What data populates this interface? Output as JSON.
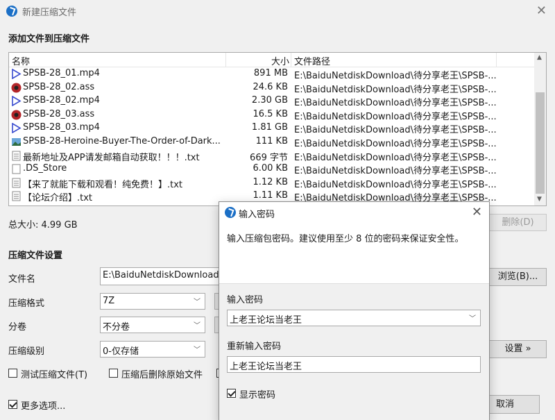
{
  "window": {
    "title": "新建压缩文件",
    "close_glyph": "✕"
  },
  "files_section": {
    "title": "添加文件到压缩文件"
  },
  "list": {
    "columns": [
      "名称",
      "大小",
      "文件路径"
    ],
    "rows": [
      {
        "name": "SPSB-28_01.mp4",
        "size": "891 MB",
        "path": "E:\\BaiduNetdiskDownload\\待分享老王\\SPSB-...",
        "icon": "video-file-icon"
      },
      {
        "name": "SPSB-28_02.ass",
        "size": "24.6 KB",
        "path": "E:\\BaiduNetdiskDownload\\待分享老王\\SPSB-...",
        "icon": "subtitle-file-icon"
      },
      {
        "name": "SPSB-28_02.mp4",
        "size": "2.30 GB",
        "path": "E:\\BaiduNetdiskDownload\\待分享老王\\SPSB-...",
        "icon": "video-file-icon"
      },
      {
        "name": "SPSB-28_03.ass",
        "size": "16.5 KB",
        "path": "E:\\BaiduNetdiskDownload\\待分享老王\\SPSB-...",
        "icon": "subtitle-file-icon"
      },
      {
        "name": "SPSB-28_03.mp4",
        "size": "1.81 GB",
        "path": "E:\\BaiduNetdiskDownload\\待分享老王\\SPSB-...",
        "icon": "video-file-icon"
      },
      {
        "name": "SPSB-28-Heroine-Buyer-The-Order-of-Dark...",
        "size": "111 KB",
        "path": "E:\\BaiduNetdiskDownload\\待分享老王\\SPSB-...",
        "icon": "image-file-icon"
      },
      {
        "name": "最新地址及APP请发邮箱自动获取！！！.txt",
        "size": "669 字节",
        "path": "E:\\BaiduNetdiskDownload\\待分享老王\\SPSB-...",
        "icon": "text-file-icon"
      },
      {
        "name": ".DS_Store",
        "size": "6.00 KB",
        "path": "E:\\BaiduNetdiskDownload\\待分享老王\\SPSB-...",
        "icon": "blank-file-icon"
      },
      {
        "name": "【来了就能下载和观看！纯免费！】.txt",
        "size": "1.12 KB",
        "path": "E:\\BaiduNetdiskDownload\\待分享老王\\SPSB-...",
        "icon": "text-file-icon"
      },
      {
        "name": "【论坛介绍】.txt",
        "size": "1.11 KB",
        "path": "E:\\BaiduNetdiskDownload\\待分享老王\\SPSB-...",
        "icon": "text-file-icon"
      }
    ]
  },
  "total": {
    "label": "总大小: 4.99 GB"
  },
  "delete_button": "删除(D)",
  "settings": {
    "title": "压缩文件设置",
    "filename_label": "文件名",
    "filename_value": "E:\\BaiduNetdiskDownload\\",
    "browse_button": "浏览(B)...",
    "format_label": "压缩格式",
    "format_value": "7Z",
    "volume_label": "分卷",
    "volume_value": "不分卷",
    "level_label": "压缩级别",
    "level_value": "0-仅存储",
    "advanced_button": "设置 »",
    "test_label": "测试压缩文件(T)",
    "delete_after_label": "压缩后删除原始文件",
    "more_options_label": "更多选项...",
    "cancel_button": "取消"
  },
  "dialog": {
    "title": "输入密码",
    "close_glyph": "✕",
    "description": "输入压缩包密码。建议使用至少 8 位的密码来保证安全性。",
    "password_label": "输入密码",
    "password_value": "上老王论坛当老王",
    "confirm_label": "重新输入密码",
    "confirm_value": "上老王论坛当老王",
    "show_password_label": "显示密码"
  },
  "colors": {
    "accent": "#1b6fc6",
    "window_bg": "#f0f0f0",
    "scrollbar_thumb": "#c1c1c1"
  }
}
